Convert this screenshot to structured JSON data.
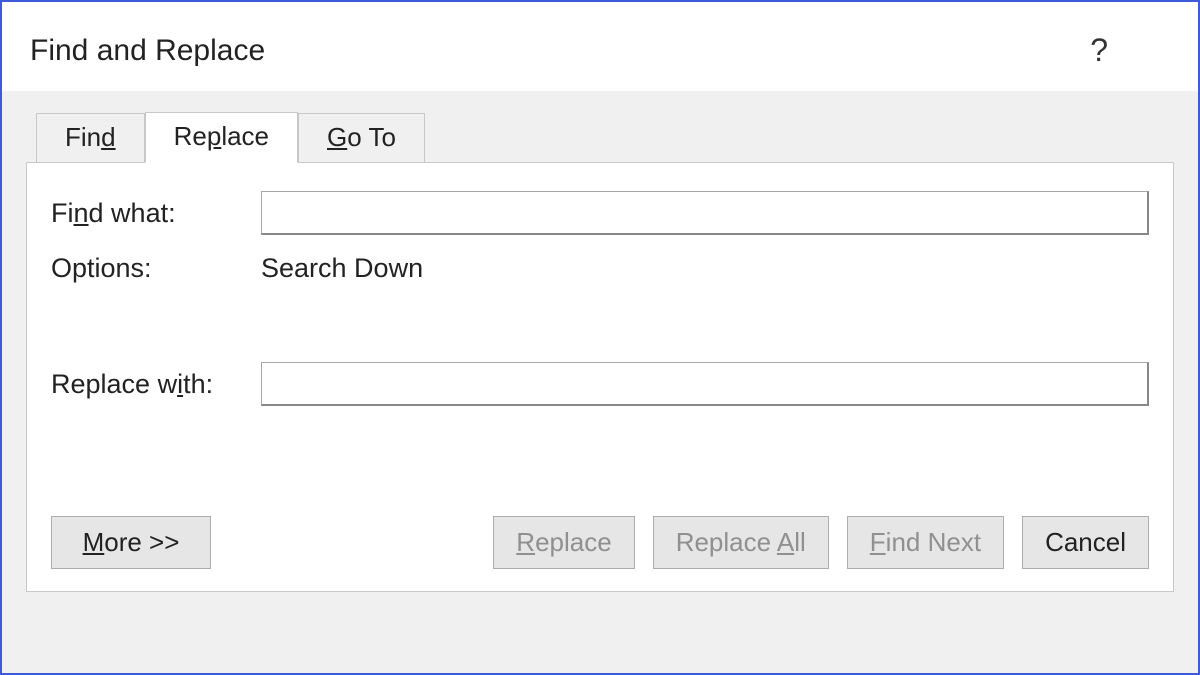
{
  "titlebar": {
    "title": "Find and Replace",
    "help": "?"
  },
  "tabs": {
    "find_pre": "Fin",
    "find_ul": "d",
    "find_post": "",
    "replace_pre": "Re",
    "replace_ul": "p",
    "replace_post": "lace",
    "goto_pre": "",
    "goto_ul": "G",
    "goto_post": "o To"
  },
  "labels": {
    "find_what_pre": "Fi",
    "find_what_ul": "n",
    "find_what_post": "d what:",
    "options": "Options:",
    "replace_with_pre": "Replace w",
    "replace_with_ul": "i",
    "replace_with_post": "th:"
  },
  "values": {
    "find_what": "",
    "options": "Search Down",
    "replace_with": ""
  },
  "buttons": {
    "more_pre": "",
    "more_ul": "M",
    "more_post": "ore >>",
    "replace_pre": "",
    "replace_ul": "R",
    "replace_post": "eplace",
    "replace_all_pre": "Replace ",
    "replace_all_ul": "A",
    "replace_all_post": "ll",
    "find_next_pre": "",
    "find_next_ul": "F",
    "find_next_post": "ind Next",
    "cancel": "Cancel"
  }
}
